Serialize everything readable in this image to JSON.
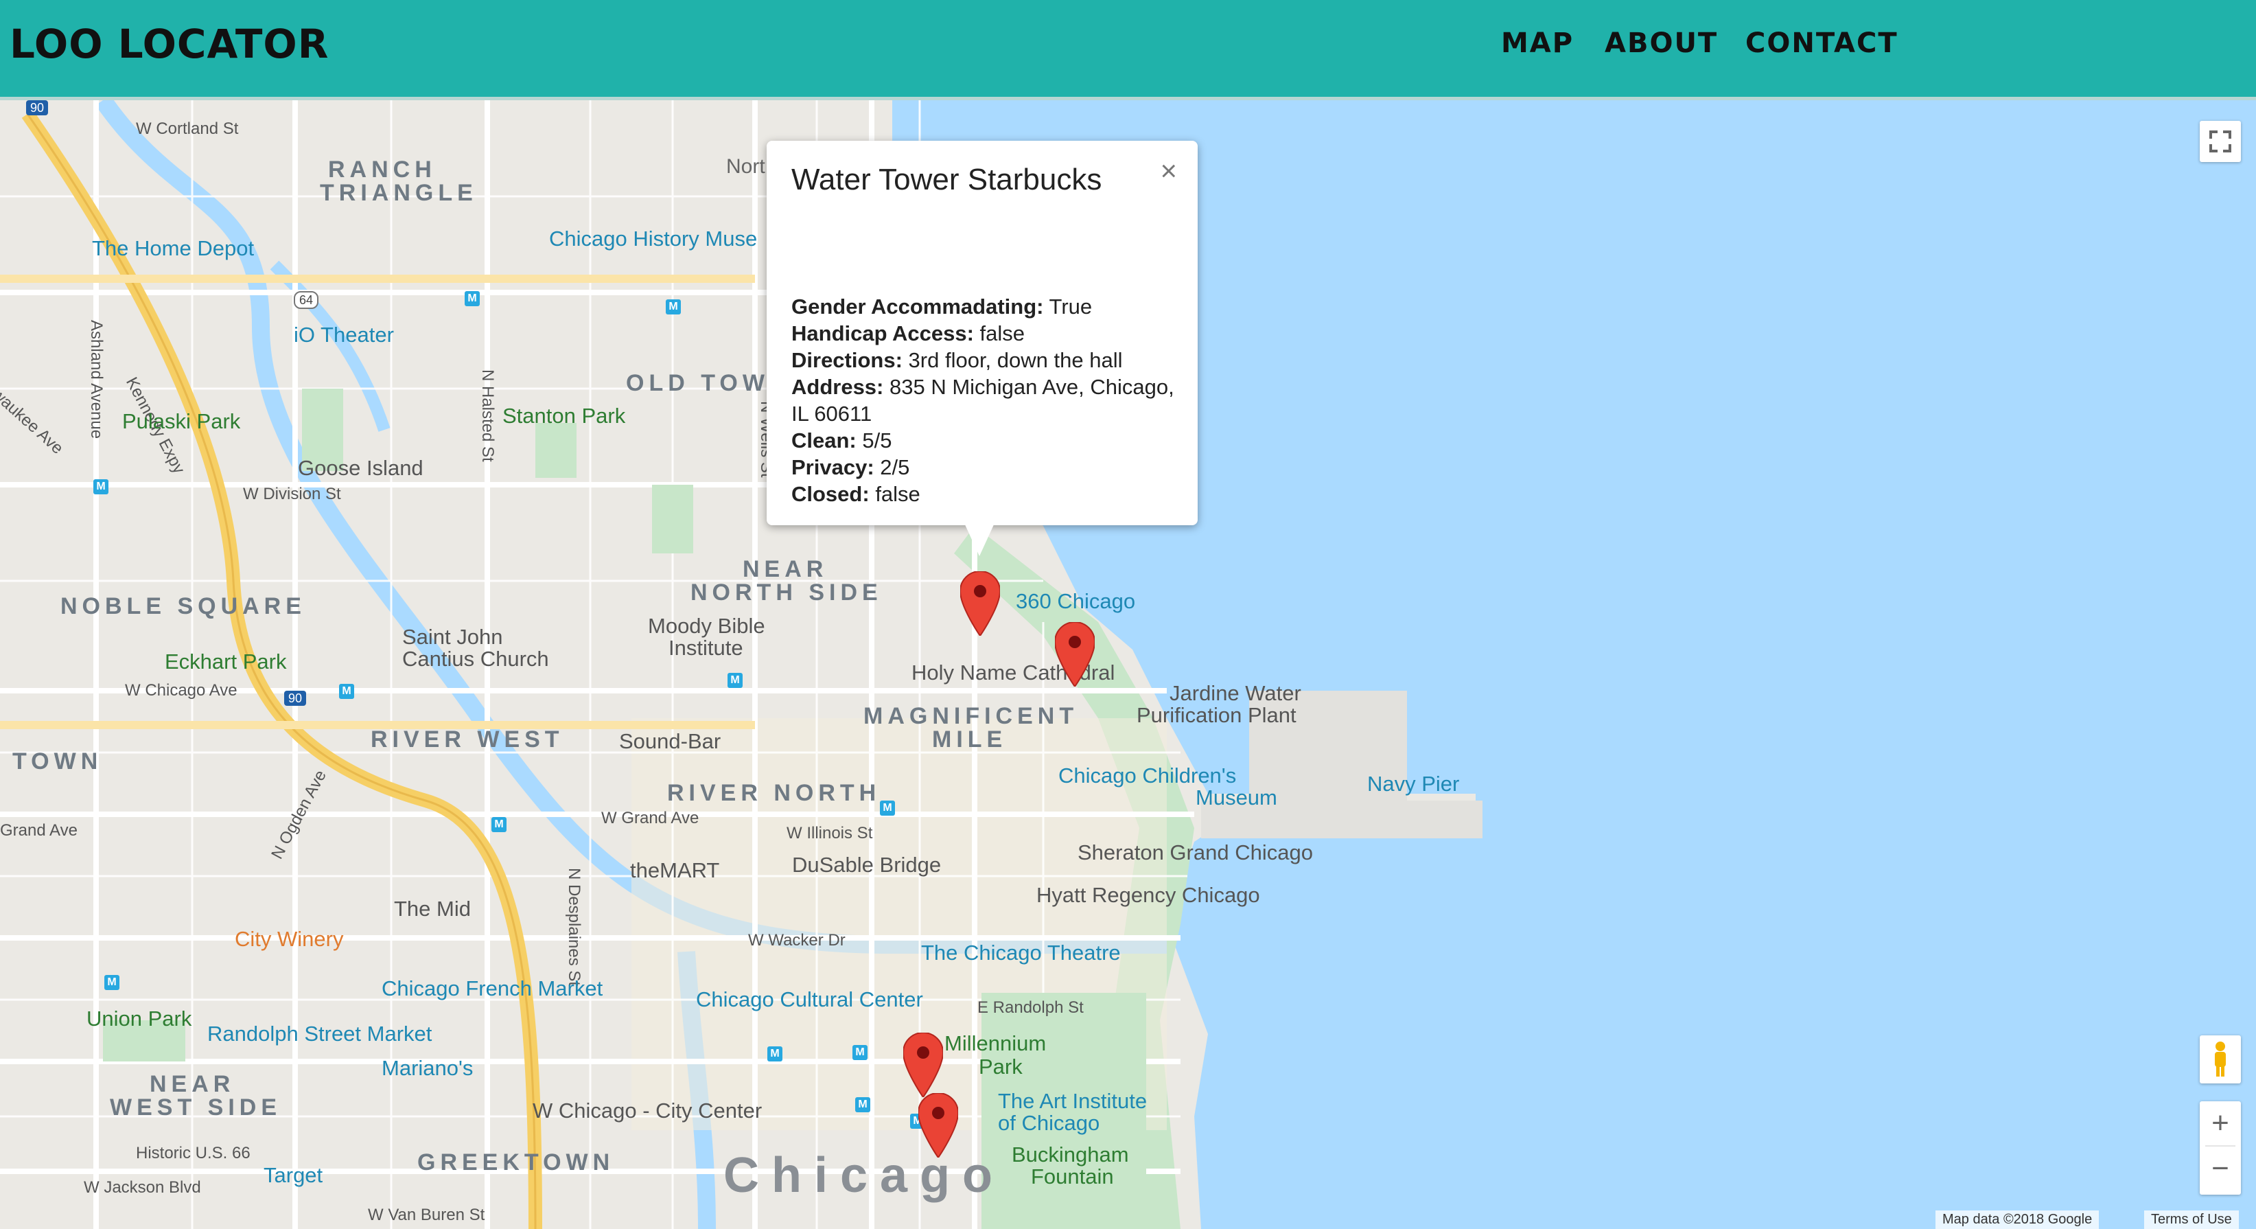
{
  "brand": "LOO LOCATOR",
  "nav": [
    "MAP",
    "ABOUT",
    "CONTACT"
  ],
  "info": {
    "title": "Water Tower Starbucks",
    "close": "×",
    "rows": [
      {
        "label": "Gender Accommadating:",
        "value": "True"
      },
      {
        "label": "Handicap Access:",
        "value": "false"
      },
      {
        "label": "Directions:",
        "value": "3rd floor, down the hall"
      },
      {
        "label": "Address:",
        "value": "835 N Michigan Ave, Chicago, IL 60611"
      },
      {
        "label": "Clean:",
        "value": "5/5"
      },
      {
        "label": "Privacy:",
        "value": "2/5"
      },
      {
        "label": "Closed:",
        "value": "false"
      }
    ]
  },
  "map_labels": {
    "neighborhoods": [
      "RANCH",
      "TRIANGLE",
      "OLD TOWN",
      "NEAR",
      "NORTH SIDE",
      "NOBLE SQUARE",
      "RIVER WEST",
      "RIVER NORTH",
      "MAGNIFICENT",
      "MILE",
      "TOWN",
      "NEAR",
      "WEST SIDE",
      "GREEKTOWN"
    ],
    "roads": [
      "W Cortland St",
      "Kennedy Expy",
      "Ashland Avenue",
      "waukee Ave",
      "N Halsted St",
      "N Wells St",
      "W Division St",
      "W Chicago Ave",
      "N Ogden Ave",
      "W Grand Ave",
      "Grand Ave",
      "W Illinois St",
      "N Desplaines St",
      "W Wacker Dr",
      "E Randolph St",
      "Historic U.S. 66",
      "W Jackson Blvd",
      "W Van Buren St",
      "Nort"
    ],
    "shields": [
      "90",
      "64",
      "90"
    ],
    "places": [
      "The Home Depot",
      "Chicago History Muse",
      "iO Theater",
      "Pulaski Park",
      "Stanton Park",
      "Goose Island",
      "Moody Bible",
      "Institute",
      "360 Chicago",
      "Saint John",
      "Cantius Church",
      "Holy Name Cathedral",
      "Eckhart Park",
      "Jardine Water",
      "Purification Plant",
      "Sound-Bar",
      "Chicago Children's",
      "Museum",
      "Navy Pier",
      "theMART",
      "DuSable Bridge",
      "Sheraton Grand Chicago",
      "Hyatt Regency Chicago",
      "The Mid",
      "City Winery",
      "The Chicago Theatre",
      "Chicago French Market",
      "Chicago Cultural Center",
      "Union Park",
      "Randolph Street Market",
      "Millennium",
      "Park",
      "Mariano's",
      "W Chicago - City Center",
      "The Art Institute",
      "of Chicago",
      "Target",
      "Buckingham",
      "Fountain",
      "Chicago"
    ],
    "attribution": [
      "Map data ©2018 Google",
      "Terms of Use"
    ]
  },
  "controls": {
    "zoom_in": "+",
    "zoom_out": "−",
    "metro": "M"
  }
}
